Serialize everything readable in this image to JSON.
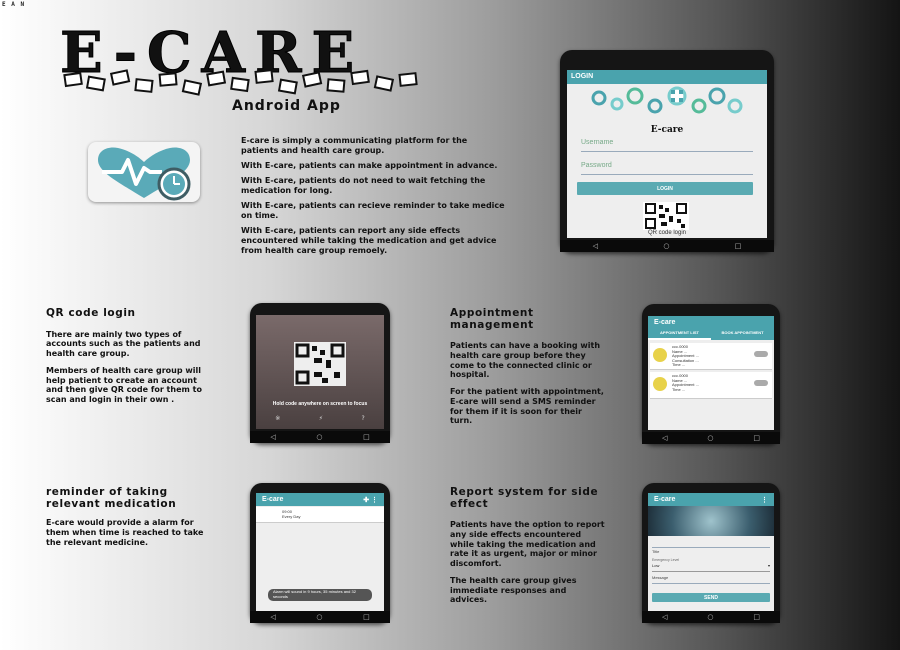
{
  "corner_tag": "E A N",
  "header": {
    "title": "E-CARE",
    "subtitle": "Android App"
  },
  "intro_paragraphs": [
    "E-care is simply a communicating platform for the patients and health care group.",
    "With E-care, patients can make appointment in advance.",
    "With E-care, patients do not need to wait fetching the medication for long.",
    "With E-care, patients can recieve reminder to take medice on time.",
    "With E-care, patients can report any side effects encountered while taking the medication and get advice from health care group remoely."
  ],
  "login_screen": {
    "appbar_title": "LOGIN",
    "app_name": "E-care",
    "username_placeholder": "Username",
    "password_placeholder": "Password",
    "login_button": "LOGIN",
    "qr_caption": "QR code login"
  },
  "sections": {
    "qr": {
      "title": "QR code login",
      "paragraphs": [
        "There are mainly two types of accounts such as the patients and health care group.",
        "Members of health care group will help patient to create an account and then give QR code for them to scan and login in their own ."
      ],
      "scan_hint": "Hold code anywhere on screen to focus"
    },
    "appointment": {
      "title": "Appointment management",
      "paragraphs": [
        "Patients can have a booking with health care group before they come to the connected clinic or hospital.",
        "For the patient with appointment, E-care will send a SMS reminder for them if it is soon for their turn."
      ],
      "appbar_title": "E-care",
      "tabs": [
        "APPOINTMENT LIST",
        "BOOK APPOINTMENT"
      ],
      "items": [
        {
          "lines": [
            "ccc.0000",
            "Name ...",
            "Appointment ...",
            "Consultation ...",
            "Time ..."
          ]
        },
        {
          "lines": [
            "ccc.0000",
            "Name ...",
            "Appointment ...",
            "Time ..."
          ]
        }
      ]
    },
    "reminder": {
      "title": "reminder of taking relevant medication",
      "paragraphs": [
        "E-care would provide a alarm for them when time is reached to take the relevant medicine."
      ],
      "appbar_title": "E-care",
      "item_title": "09:00",
      "item_sub": "Every Day",
      "toast": "Alarm will sound in 9 hours, 35 minutes and 32 seconds"
    },
    "report": {
      "title": "Report system for side effect",
      "paragraphs": [
        "Patients have the option to report any side effects encountered while taking the medication and rate it as urgent, major or minor discomfort.",
        "The health care group gives immediate responses and advices."
      ],
      "appbar_title": "E-care",
      "title_label": "Title",
      "emergency_label": "Emergency Level",
      "emergency_value": "Low",
      "message_label": "Message",
      "send_button": "SEND"
    }
  },
  "colors": {
    "accent": "#4aa3ad",
    "heart": "#5aaab8",
    "phone": "#151515"
  }
}
